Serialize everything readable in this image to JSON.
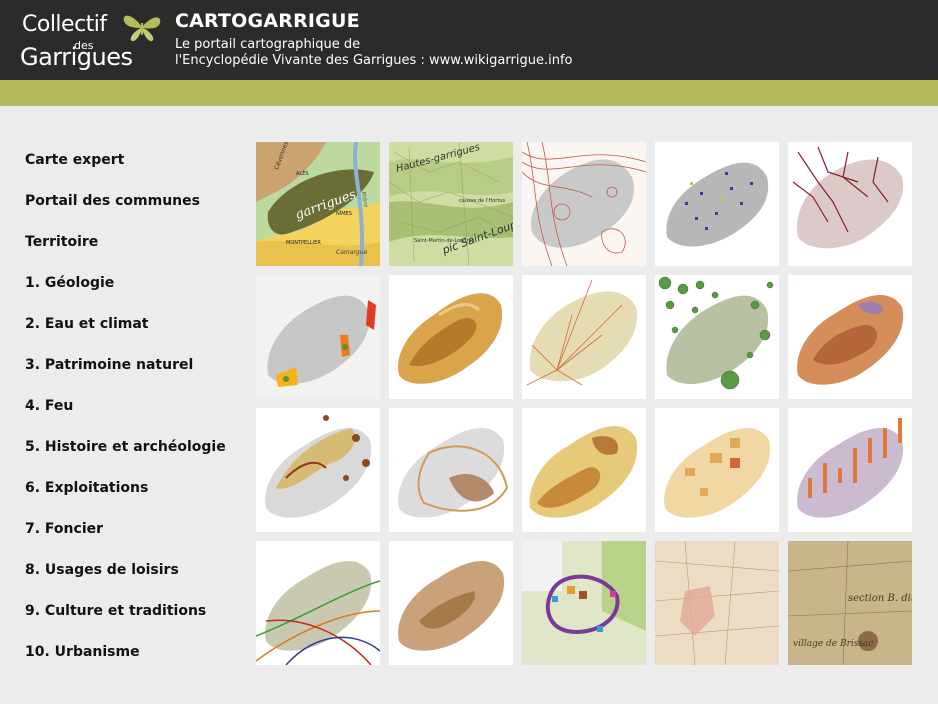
{
  "header": {
    "logo_line1": "Collectif",
    "logo_line2": "des",
    "logo_line3": "Garrigues",
    "title": "CARTOGARRIGUE",
    "subtitle_line1": "Le portail cartographique de",
    "subtitle_line2": "l'Encyclopédie Vivante des Garrigues : www.wikigarrigue.info"
  },
  "colors": {
    "header_bg": "#2b2b2b",
    "accent_band": "#b4bb5a",
    "page_bg": "#ececec"
  },
  "nav": {
    "items": [
      {
        "label": "Carte expert"
      },
      {
        "label": "Portail des communes"
      },
      {
        "label": "Territoire"
      },
      {
        "label": "1. Géologie"
      },
      {
        "label": "2. Eau et climat"
      },
      {
        "label": "3. Patrimoine naturel"
      },
      {
        "label": "4. Feu"
      },
      {
        "label": "5. Histoire et archéologie"
      },
      {
        "label": "6. Exploitations"
      },
      {
        "label": "7. Foncier"
      },
      {
        "label": "8. Usages de loisirs"
      },
      {
        "label": "9. Culture et traditions"
      },
      {
        "label": "10. Urbanisme"
      }
    ]
  },
  "thumbnails": {
    "t1": {
      "label_1": "garrigues",
      "label_2": "Cévennes",
      "label_3": "ALÈS",
      "label_4": "NÎMES",
      "label_5": "MONTPELLIER",
      "label_6": "Camargue",
      "label_7": "Rhône"
    },
    "t2": {
      "label_1": "Hautes-garrigues",
      "label_2": "causse de l'Hortus",
      "label_3": "pic Saint-Loup",
      "label_4": "Saint-Martin-de-Londres"
    },
    "t20": {
      "label_1": "section B. dit",
      "label_2": "village de Brissac"
    }
  }
}
